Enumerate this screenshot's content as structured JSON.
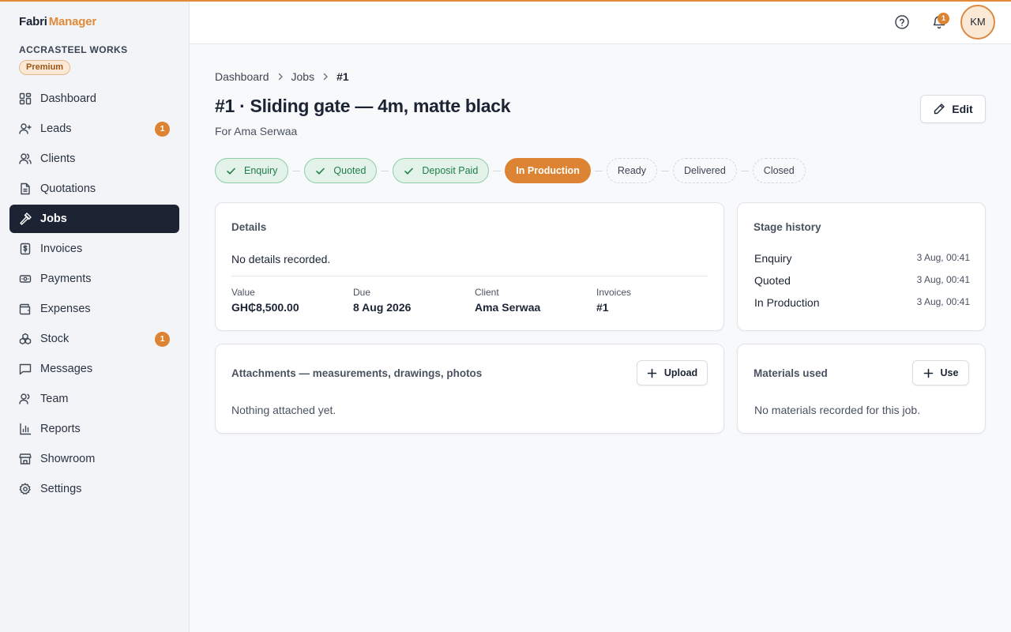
{
  "brand": {
    "part1": "Fabri",
    "part2": "Manager"
  },
  "company": {
    "name": "ACCRASTEEL WORKS",
    "plan": "Premium"
  },
  "sidebar": {
    "items": [
      {
        "label": "Dashboard",
        "icon": "dashboard-icon"
      },
      {
        "label": "Leads",
        "icon": "user-plus-icon",
        "badge": "1"
      },
      {
        "label": "Clients",
        "icon": "users-icon"
      },
      {
        "label": "Quotations",
        "icon": "document-icon"
      },
      {
        "label": "Jobs",
        "icon": "hammer-icon",
        "active": true
      },
      {
        "label": "Invoices",
        "icon": "invoice-dollar-icon"
      },
      {
        "label": "Payments",
        "icon": "banknote-icon"
      },
      {
        "label": "Expenses",
        "icon": "wallet-icon"
      },
      {
        "label": "Stock",
        "icon": "boxes-icon",
        "badge": "1"
      },
      {
        "label": "Messages",
        "icon": "message-icon"
      },
      {
        "label": "Team",
        "icon": "team-icon"
      },
      {
        "label": "Reports",
        "icon": "bar-chart-icon"
      },
      {
        "label": "Showroom",
        "icon": "store-icon"
      },
      {
        "label": "Settings",
        "icon": "gear-icon"
      }
    ]
  },
  "header": {
    "notification_count": "1",
    "avatar_initials": "KM"
  },
  "breadcrumb": {
    "items": [
      "Dashboard",
      "Jobs"
    ],
    "current": "#1"
  },
  "job": {
    "title": "#1 · Sliding gate — 4m, matte black",
    "subtitle": "For Ama Serwaa",
    "edit_label": "Edit"
  },
  "stages": [
    {
      "label": "Enquiry",
      "state": "done"
    },
    {
      "label": "Quoted",
      "state": "done"
    },
    {
      "label": "Deposit Paid",
      "state": "done"
    },
    {
      "label": "In Production",
      "state": "current"
    },
    {
      "label": "Ready",
      "state": "todo"
    },
    {
      "label": "Delivered",
      "state": "todo"
    },
    {
      "label": "Closed",
      "state": "todo"
    }
  ],
  "details": {
    "title": "Details",
    "empty_text": "No details recorded.",
    "fields": [
      {
        "label": "Value",
        "value": "GH₵8,500.00"
      },
      {
        "label": "Due",
        "value": "8 Aug 2026"
      },
      {
        "label": "Client",
        "value": "Ama Serwaa"
      },
      {
        "label": "Invoices",
        "value": "#1"
      }
    ]
  },
  "stage_history": {
    "title": "Stage history",
    "rows": [
      {
        "stage": "Enquiry",
        "time": "3 Aug, 00:41"
      },
      {
        "stage": "Quoted",
        "time": "3 Aug, 00:41"
      },
      {
        "stage": "In Production",
        "time": "3 Aug, 00:41"
      }
    ]
  },
  "attachments": {
    "title": "Attachments — measurements, drawings, photos",
    "button_label": "Upload",
    "empty_text": "Nothing attached yet."
  },
  "materials": {
    "title": "Materials used",
    "button_label": "Use",
    "empty_text": "No materials recorded for this job."
  },
  "colors": {
    "accent": "#dd8434",
    "sidebar_active": "#1c2434",
    "success": "#1f7d49"
  }
}
